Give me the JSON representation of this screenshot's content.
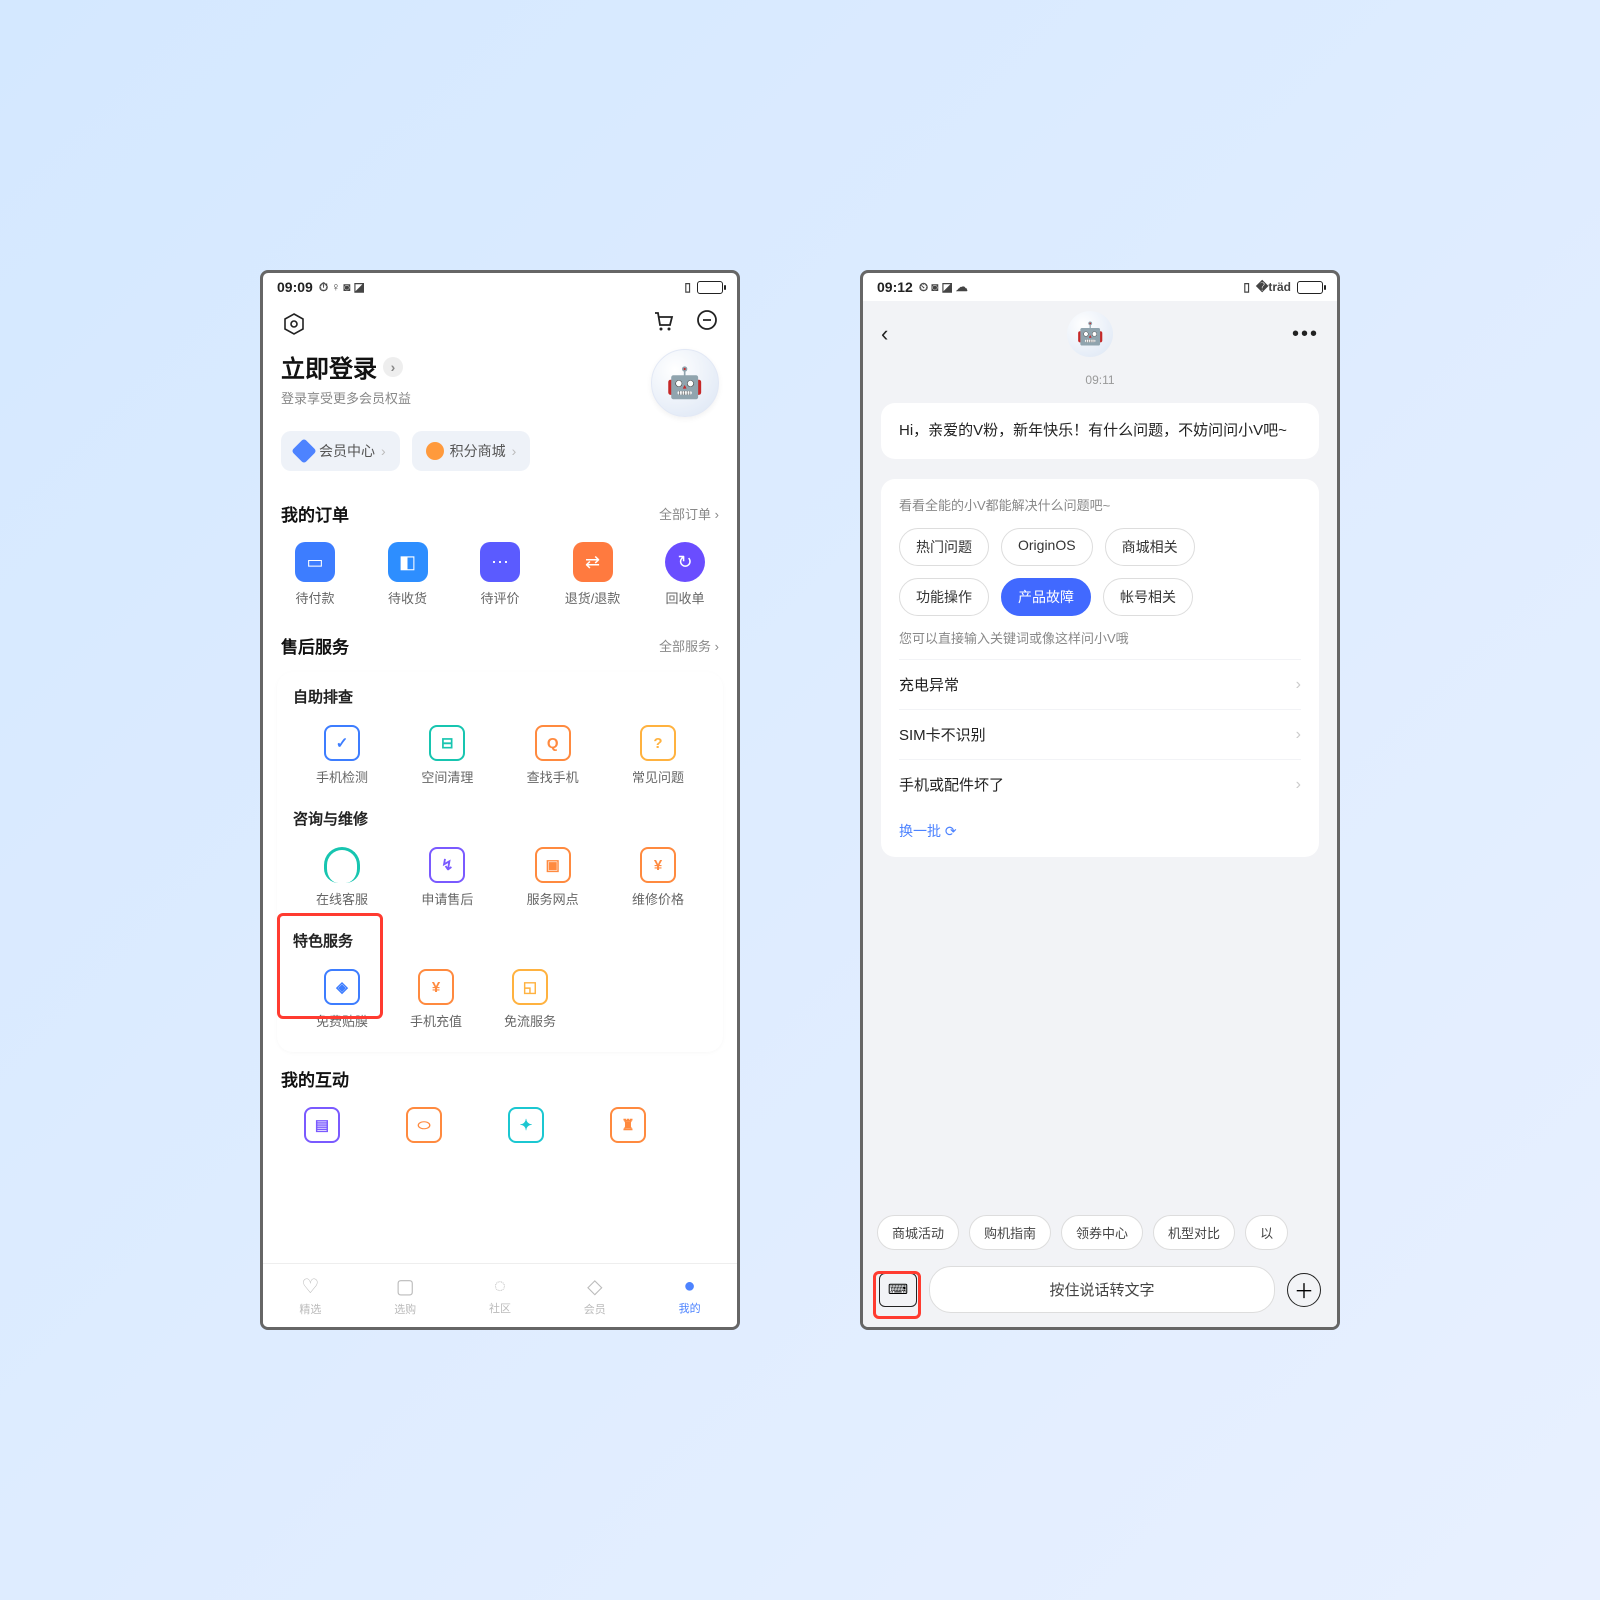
{
  "left": {
    "status_time": "09:09",
    "header": {
      "login_title": "立即登录",
      "login_sub": "登录享受更多会员权益"
    },
    "pills": {
      "member": "会员中心",
      "points": "积分商城"
    },
    "orders": {
      "title": "我的订单",
      "more": "全部订单",
      "items": [
        {
          "label": "待付款"
        },
        {
          "label": "待收货"
        },
        {
          "label": "待评价"
        },
        {
          "label": "退货/退款"
        },
        {
          "label": "回收单"
        }
      ]
    },
    "after": {
      "title": "售后服务",
      "more": "全部服务",
      "g1_title": "自助排查",
      "g1": [
        {
          "label": "手机检测"
        },
        {
          "label": "空间清理"
        },
        {
          "label": "查找手机"
        },
        {
          "label": "常见问题"
        }
      ],
      "g2_title": "咨询与维修",
      "g2": [
        {
          "label": "在线客服"
        },
        {
          "label": "申请售后"
        },
        {
          "label": "服务网点"
        },
        {
          "label": "维修价格"
        }
      ],
      "g3_title": "特色服务",
      "g3": [
        {
          "label": "免费贴膜"
        },
        {
          "label": "手机充值"
        },
        {
          "label": "免流服务"
        }
      ]
    },
    "interact_title": "我的互动",
    "tabs": [
      {
        "label": "精选"
      },
      {
        "label": "选购"
      },
      {
        "label": "社区"
      },
      {
        "label": "会员"
      },
      {
        "label": "我的"
      }
    ]
  },
  "right": {
    "status_time": "09:12",
    "timestamp": "09:11",
    "greeting": "Hi，亲爱的V粉，新年快乐！有什么问题，不妨问问小V吧~",
    "hint1": "看看全能的小V都能解决什么问题吧~",
    "chips": [
      {
        "label": "热门问题",
        "active": false
      },
      {
        "label": "OriginOS",
        "active": false
      },
      {
        "label": "商城相关",
        "active": false
      },
      {
        "label": "功能操作",
        "active": false
      },
      {
        "label": "产品故障",
        "active": true
      },
      {
        "label": "帐号相关",
        "active": false
      }
    ],
    "hint2": "您可以直接输入关键词或像这样问小V哦",
    "questions": [
      {
        "label": "充电异常"
      },
      {
        "label": "SIM卡不识别"
      },
      {
        "label": "手机或配件坏了"
      }
    ],
    "refresh": "换一批",
    "quick": [
      {
        "label": "商城活动"
      },
      {
        "label": "购机指南"
      },
      {
        "label": "领券中心"
      },
      {
        "label": "机型对比"
      },
      {
        "label": "以"
      }
    ],
    "voice_label": "按住说话转文字"
  }
}
